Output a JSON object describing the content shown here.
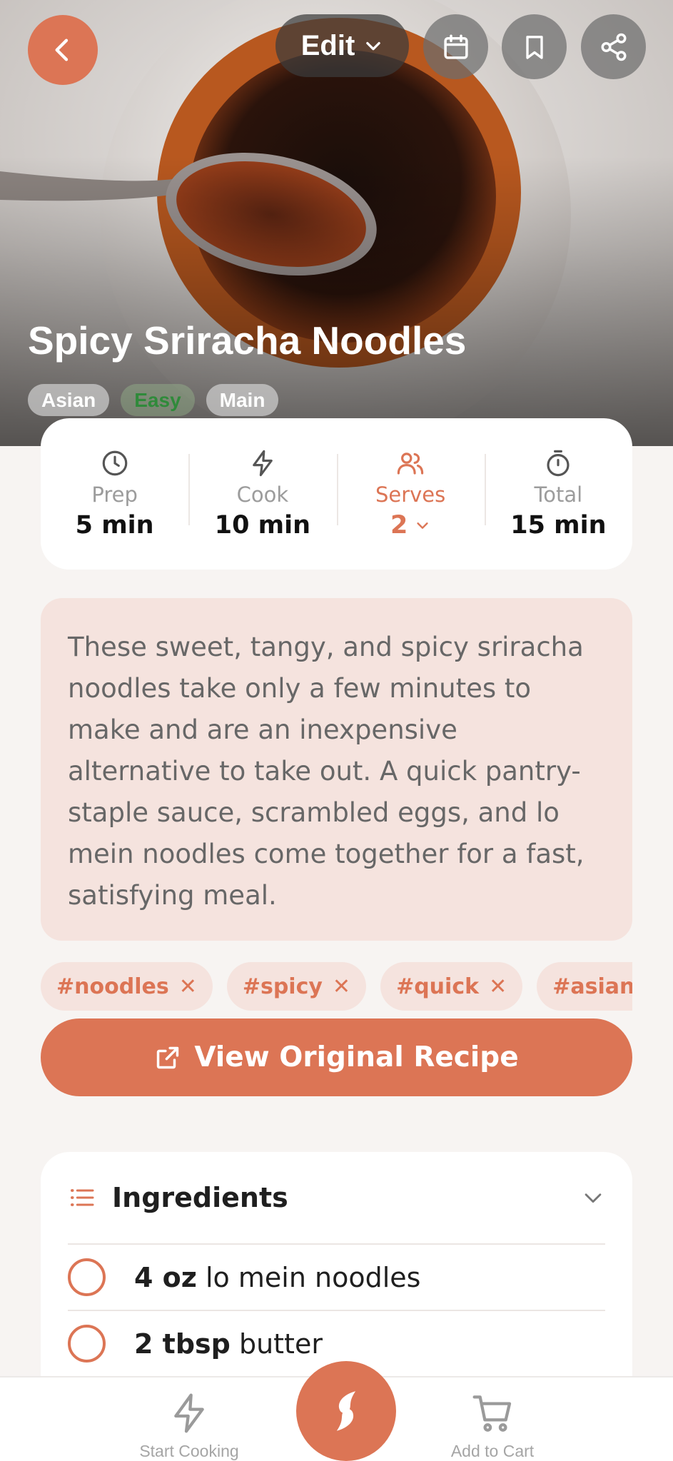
{
  "header": {
    "edit_label": "Edit",
    "title": "Spicy Sriracha Noodles",
    "tags": [
      "Asian",
      "Easy",
      "Main"
    ],
    "icons": {
      "back": "chevron-left-icon",
      "edit_caret": "chevron-down-icon",
      "calendar": "calendar-icon",
      "bookmark": "bookmark-icon",
      "share": "share-icon"
    }
  },
  "stats": {
    "prep": {
      "label": "Prep",
      "value": "5 min",
      "icon": "clock-icon"
    },
    "cook": {
      "label": "Cook",
      "value": "10 min",
      "icon": "bolt-icon"
    },
    "serves": {
      "label": "Serves",
      "value": "2",
      "icon": "users-icon"
    },
    "total": {
      "label": "Total",
      "value": "15 min",
      "icon": "stopwatch-icon"
    }
  },
  "description": "These sweet, tangy, and spicy sriracha noodles take only a few minutes to make and are an inexpensive alternative to take out. A quick pantry-staple sauce, scrambled eggs, and lo mein noodles come together for a fast, satisfying meal.",
  "hashtags": [
    "#noodles",
    "#spicy",
    "#quick",
    "#asian"
  ],
  "view_original_label": "View Original Recipe",
  "ingredients": {
    "title": "Ingredients",
    "items": [
      {
        "qty": "4 oz",
        "name": "lo mein noodles"
      },
      {
        "qty": "2 tbsp",
        "name": "butter"
      }
    ]
  },
  "bottom_bar": {
    "start_cooking": "Start Cooking",
    "add_to_cart": "Add to Cart"
  },
  "colors": {
    "accent": "#dc7555",
    "accent_soft": "#f5e3de",
    "easy_tag_text": "#2f8a3a"
  }
}
